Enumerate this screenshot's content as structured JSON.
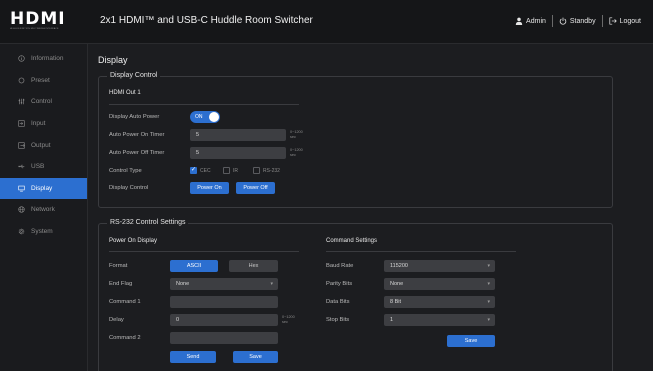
{
  "brand": {
    "logo_text": "HDMI",
    "logo_sub": "HIGH-DEFINITION MULTIMEDIA INTERFACE"
  },
  "header": {
    "title": "2x1 HDMI™ and USB-C Huddle Room Switcher",
    "user": "Admin",
    "standby": "Standby",
    "logout": "Logout"
  },
  "sidebar": {
    "items": [
      {
        "label": "Information",
        "icon": "info-icon"
      },
      {
        "label": "Preset",
        "icon": "preset-icon"
      },
      {
        "label": "Control",
        "icon": "control-icon"
      },
      {
        "label": "Input",
        "icon": "input-icon"
      },
      {
        "label": "Output",
        "icon": "output-icon"
      },
      {
        "label": "USB",
        "icon": "usb-icon"
      },
      {
        "label": "Display",
        "icon": "display-icon",
        "active": true
      },
      {
        "label": "Network",
        "icon": "network-icon"
      },
      {
        "label": "System",
        "icon": "gear-icon"
      }
    ]
  },
  "page": {
    "title": "Display"
  },
  "display_control": {
    "legend": "Display Control",
    "output": "HDMI Out 1",
    "auto_power_label": "Display Auto Power",
    "auto_power_state": "ON",
    "on_timer_label": "Auto Power On Timer",
    "on_timer_value": "5",
    "on_timer_unit": "0~1200 sec",
    "off_timer_label": "Auto Power Off Timer",
    "off_timer_value": "5",
    "off_timer_unit": "0~1200 sec",
    "control_type_label": "Control Type",
    "control_types": [
      "CEC",
      "IR",
      "RS-232"
    ],
    "control_type_checked": [
      true,
      false,
      false
    ],
    "display_control_label": "Display Control",
    "power_on": "Power On",
    "power_off": "Power Off"
  },
  "rs232": {
    "legend": "RS-232 Control Settings",
    "power_on_display": {
      "title": "Power On Display",
      "format_label": "Format",
      "format_ascii": "ASCII",
      "format_hex": "Hex",
      "end_flag_label": "End Flag",
      "end_flag_value": "None",
      "command1_label": "Command 1",
      "command1_value": "",
      "delay_label": "Delay",
      "delay_value": "0",
      "delay_unit": "0~1200 sec",
      "command2_label": "Command 2",
      "command2_value": "",
      "send": "Send",
      "save": "Save"
    },
    "command_settings": {
      "title": "Command Settings",
      "baud_label": "Baud Rate",
      "baud_value": "115200",
      "parity_label": "Parity Bits",
      "parity_value": "None",
      "data_label": "Data Bits",
      "data_value": "8 Bit",
      "stop_label": "Stop Bits",
      "stop_value": "1",
      "save": "Save"
    }
  },
  "colors": {
    "accent": "#2c6fd0",
    "background": "#1c1d20",
    "sidebar": "#1a1b1e"
  }
}
